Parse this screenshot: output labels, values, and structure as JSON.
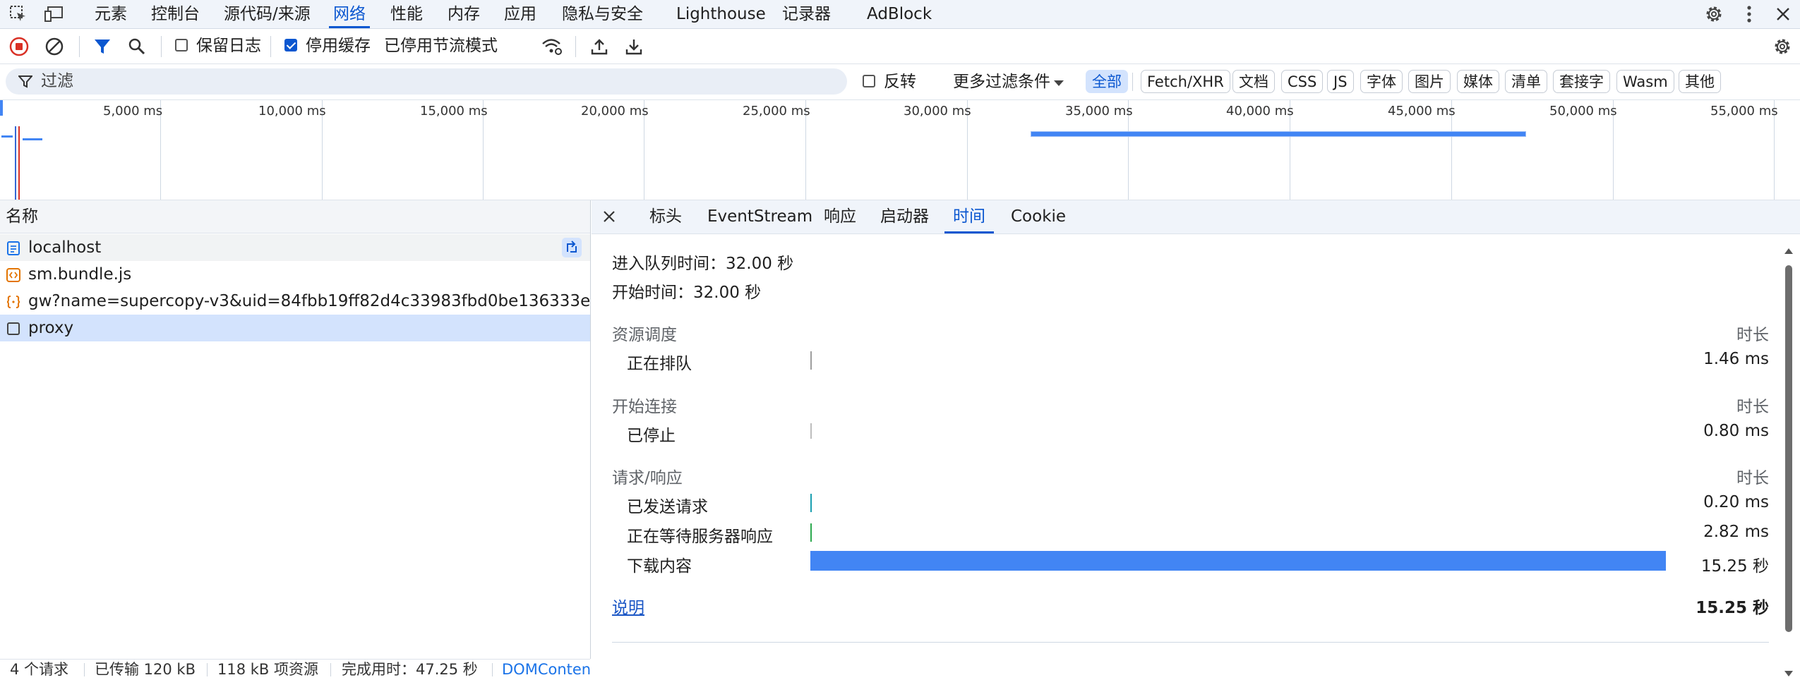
{
  "panel_tabs": [
    "元素",
    "控制台",
    "源代码/来源",
    "网络",
    "性能",
    "内存",
    "应用",
    "隐私与安全",
    "Lighthouse",
    "记录器",
    "AdBlock"
  ],
  "toolbar": {
    "preserve_log": "保留日志",
    "disable_cache": "停用缓存",
    "throttling": "已停用节流模式"
  },
  "filter": {
    "placeholder": "过滤",
    "invert": "反转",
    "more_filters": "更多过滤条件",
    "types": [
      "全部",
      "Fetch/XHR",
      "文档",
      "CSS",
      "JS",
      "字体",
      "图片",
      "媒体",
      "清单",
      "套接字",
      "Wasm",
      "其他"
    ]
  },
  "overview": {
    "ticks": [
      "5,000 ms",
      "10,000 ms",
      "15,000 ms",
      "20,000 ms",
      "25,000 ms",
      "30,000 ms",
      "35,000 ms",
      "40,000 ms",
      "45,000 ms",
      "50,000 ms",
      "55,000 ms"
    ]
  },
  "requests": {
    "header": "名称",
    "rows": [
      {
        "name": "localhost",
        "icon": "document-icon"
      },
      {
        "name": "sm.bundle.js",
        "icon": "script-icon"
      },
      {
        "name": "gw?name=supercopy-v3&uid=84fbb19ff82d4c33983fbd0be136333e",
        "icon": "fetch-icon"
      },
      {
        "name": "proxy",
        "icon": "other-icon"
      }
    ]
  },
  "statusbar": {
    "requests": "4 个请求",
    "transferred": "已传输 120 kB",
    "resources": "118 kB 项资源",
    "finish": "完成用时：47.25 秒",
    "dcl": "DOMContentLoaded"
  },
  "detail_tabs": [
    "标头",
    "EventStream",
    "响应",
    "启动器",
    "时间",
    "Cookie"
  ],
  "timing": {
    "queued_at": "进入队列时间：32.00 秒",
    "started_at": "开始时间：32.00 秒",
    "duration_label": "时长",
    "sections": [
      {
        "title": "资源调度",
        "rows": [
          {
            "label": "正在排队",
            "value": "1.46 ms",
            "color": "#9e9e9e",
            "fraction": 0.0
          }
        ]
      },
      {
        "title": "开始连接",
        "rows": [
          {
            "label": "已停止",
            "value": "0.80 ms",
            "color": "#bdbdbd",
            "fraction": 0.0
          }
        ]
      },
      {
        "title": "请求/响应",
        "rows": [
          {
            "label": "已发送请求",
            "value": "0.20 ms",
            "color": "#1a9fb0",
            "fraction": 0.0
          },
          {
            "label": "正在等待服务器响应",
            "value": "2.82 ms",
            "color": "#2da94f",
            "fraction": 0.0
          },
          {
            "label": "下载内容",
            "value": "15.25 秒",
            "color": "#4285f4",
            "fraction": 1.0
          }
        ]
      }
    ],
    "explanation": "说明",
    "total": "15.25 秒"
  },
  "colors": {
    "accent": "#0b57d0",
    "record": "#d93025",
    "bar_download": "#4285f4"
  }
}
